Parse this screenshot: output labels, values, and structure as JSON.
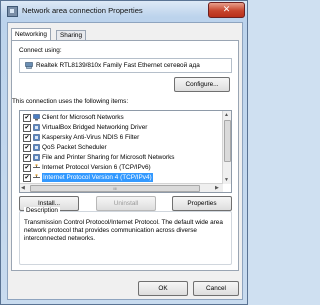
{
  "window": {
    "title": "Network area connection Properties",
    "close_label": "✕"
  },
  "tabs": [
    {
      "label": "Networking",
      "active": true
    },
    {
      "label": "Sharing",
      "active": false
    }
  ],
  "connect_using": {
    "label": "Connect using:",
    "adapter": "Realtek RTL8139/810x Family Fast Ethernet сетевой ада",
    "configure_label": "Configure..."
  },
  "items_label": "This connection uses the following items:",
  "items": [
    {
      "label": "Client for Microsoft Networks",
      "checked": true,
      "icon": "client-icon",
      "selected": false
    },
    {
      "label": "VirtualBox Bridged Networking Driver",
      "checked": true,
      "icon": "service-icon",
      "selected": false
    },
    {
      "label": "Kaspersky Anti-Virus NDIS 6 Filter",
      "checked": true,
      "icon": "service-icon",
      "selected": false
    },
    {
      "label": "QoS Packet Scheduler",
      "checked": true,
      "icon": "service-icon",
      "selected": false
    },
    {
      "label": "File and Printer Sharing for Microsoft Networks",
      "checked": true,
      "icon": "service-icon",
      "selected": false
    },
    {
      "label": "Internet Protocol Version 6 (TCP/IPv6)",
      "checked": true,
      "icon": "protocol-icon",
      "selected": false
    },
    {
      "label": "Internet Protocol Version 4 (TCP/IPv4)",
      "checked": true,
      "icon": "protocol-icon",
      "selected": true
    }
  ],
  "scrollbar": {
    "h_thumb_label": "III"
  },
  "buttons": {
    "install": "Install...",
    "uninstall": "Uninstall",
    "properties": "Properties",
    "ok": "OK",
    "cancel": "Cancel"
  },
  "description": {
    "title": "Description",
    "text": "Transmission Control Protocol/Internet Protocol. The default wide area network protocol that provides communication across diverse interconnected networks."
  },
  "colors": {
    "selection": "#3399ff",
    "title_close": "#c7452d"
  }
}
